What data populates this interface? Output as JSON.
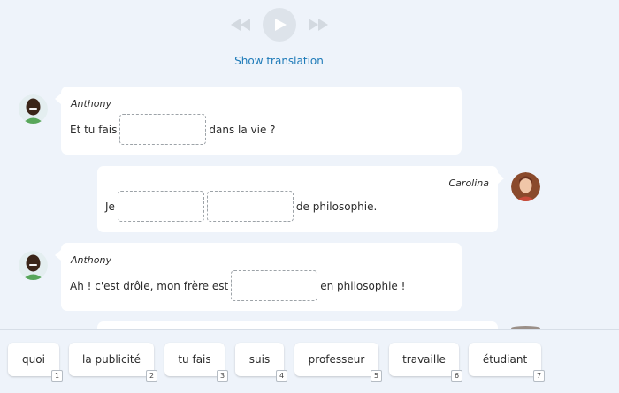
{
  "player": {
    "rewind_icon": "rewind-icon",
    "play_icon": "play-icon",
    "forward_icon": "fast-forward-icon"
  },
  "translation_link": "Show translation",
  "messages": [
    {
      "speaker": "Anthony",
      "side": "left",
      "before": "Et tu fais",
      "blanks": 1,
      "after": "dans la vie ?"
    },
    {
      "speaker": "Carolina",
      "side": "right",
      "before": "Je",
      "blanks": 2,
      "after": "de philosophie."
    },
    {
      "speaker": "Anthony",
      "side": "left",
      "before": "Ah ! c'est drôle, mon frère est",
      "blanks": 1,
      "after": "en philosophie !"
    }
  ],
  "word_bank": [
    {
      "word": "quoi",
      "key": "1"
    },
    {
      "word": "la publicité",
      "key": "2"
    },
    {
      "word": "tu fais",
      "key": "3"
    },
    {
      "word": "suis",
      "key": "4"
    },
    {
      "word": "professeur",
      "key": "5"
    },
    {
      "word": "travaille",
      "key": "6"
    },
    {
      "word": "étudiant",
      "key": "7"
    }
  ],
  "colors": {
    "background": "#eef3fa",
    "link": "#1d7ab8",
    "bubble": "#ffffff",
    "gap_border": "#9da3a8"
  }
}
